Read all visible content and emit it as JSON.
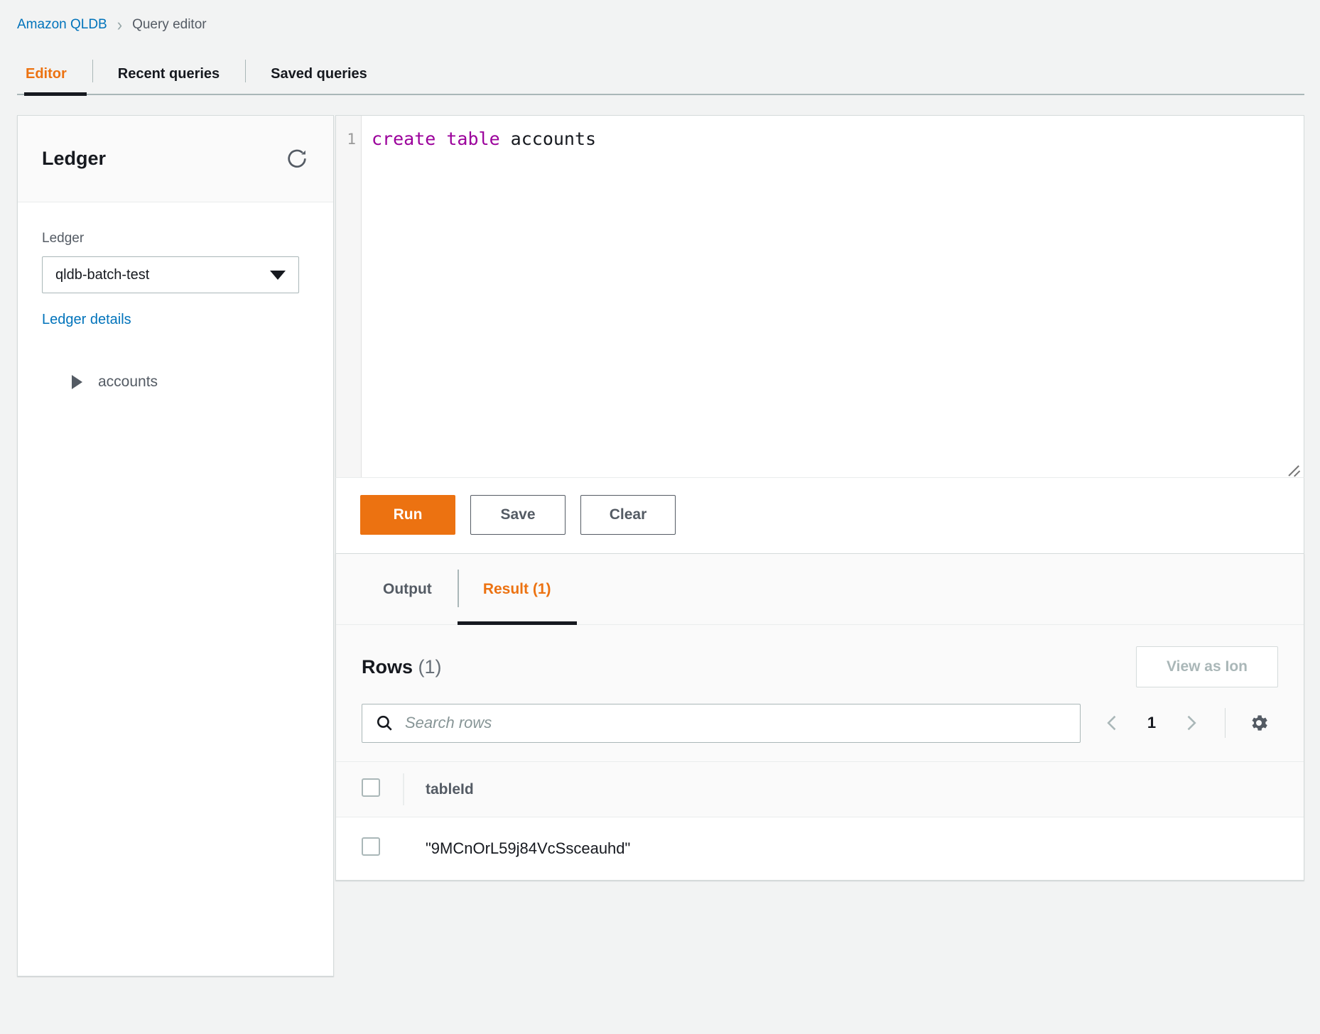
{
  "breadcrumb": {
    "service": "Amazon QLDB",
    "separator": "›",
    "current": "Query editor"
  },
  "tabs": [
    {
      "label": "Editor",
      "active": true
    },
    {
      "label": "Recent queries",
      "active": false
    },
    {
      "label": "Saved queries",
      "active": false
    }
  ],
  "ledger_panel": {
    "title": "Ledger",
    "refresh_icon": "refresh-icon",
    "field_label": "Ledger",
    "selected_ledger": "qldb-batch-test",
    "details_link": "Ledger details",
    "tree": [
      {
        "label": "accounts",
        "expanded": false
      }
    ]
  },
  "editor": {
    "line_numbers": [
      "1"
    ],
    "query_keyword": "create table",
    "query_identifier": " accounts",
    "query_full_text": "create table accounts"
  },
  "actions": {
    "run_label": "Run",
    "save_label": "Save",
    "clear_label": "Clear"
  },
  "result_panel": {
    "tabs": [
      {
        "label": "Output",
        "active": false
      },
      {
        "label": "Result (1)",
        "active": true
      }
    ],
    "rows_title": "Rows",
    "rows_count": "(1)",
    "view_as_ion_label": "View as Ion",
    "search": {
      "placeholder": "Search rows",
      "value": "",
      "icon": "search-icon"
    },
    "pagination": {
      "prev_icon": "chevron-left-icon",
      "page": "1",
      "next_icon": "chevron-right-icon",
      "settings_icon": "gear-icon"
    },
    "table": {
      "columns": [
        "tableId"
      ],
      "rows": [
        {
          "tableId": "\"9MCnOrL59j84VcSsceauhd\""
        }
      ]
    }
  },
  "colors": {
    "accent_orange": "#ec7211",
    "link_blue": "#0073bb",
    "text_dark": "#16191f",
    "text_muted": "#545b64",
    "keyword_purple": "#9b009b",
    "page_bg": "#f2f3f3"
  }
}
